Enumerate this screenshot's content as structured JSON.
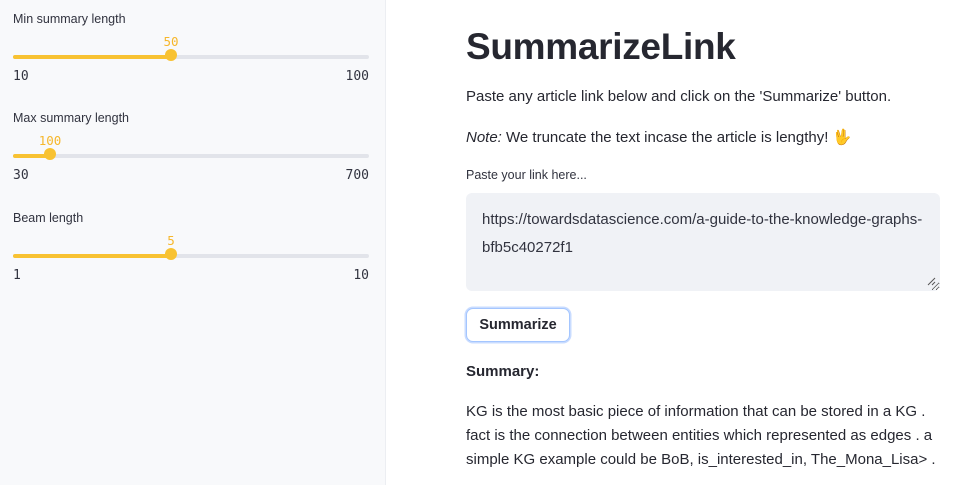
{
  "sidebar": {
    "sliders": [
      {
        "label": "Min summary length",
        "value": "50",
        "min": "10",
        "max": "100",
        "fraction": 0.444
      },
      {
        "label": "Max summary length",
        "value": "100",
        "min": "30",
        "max": "700",
        "fraction": 0.104
      },
      {
        "label": "Beam length",
        "value": "5",
        "min": "1",
        "max": "10",
        "fraction": 0.444
      }
    ]
  },
  "main": {
    "title": "SummarizeLink",
    "instruction": "Paste any article link below and click on the 'Summarize' button.",
    "note_prefix": "Note:",
    "note_text": " We truncate the text incase the article is lengthy! ",
    "note_emoji_icon": "vulcan-salute-icon",
    "note_emoji_glyph": "🖖",
    "input_label": "Paste your link here...",
    "input_value": "https://towardsdatascience.com/a-guide-to-the-knowledge-graphs-bfb5c40272f1",
    "summarize_label": "Summarize",
    "summary_heading": "Summary:",
    "summary_text": "KG is the most basic piece of information that can be stored in a KG . fact is the connection between entities which represented as edges . a simple KG example could be BoB, is_interested_in, The_Mona_Lisa> ."
  },
  "colors": {
    "accent": "#f8c232",
    "accent_text": "#f6b72c",
    "sidebar_bg": "#f8f9fb",
    "input_bg": "#f0f2f6",
    "button_focus": "#a4c6ff"
  }
}
